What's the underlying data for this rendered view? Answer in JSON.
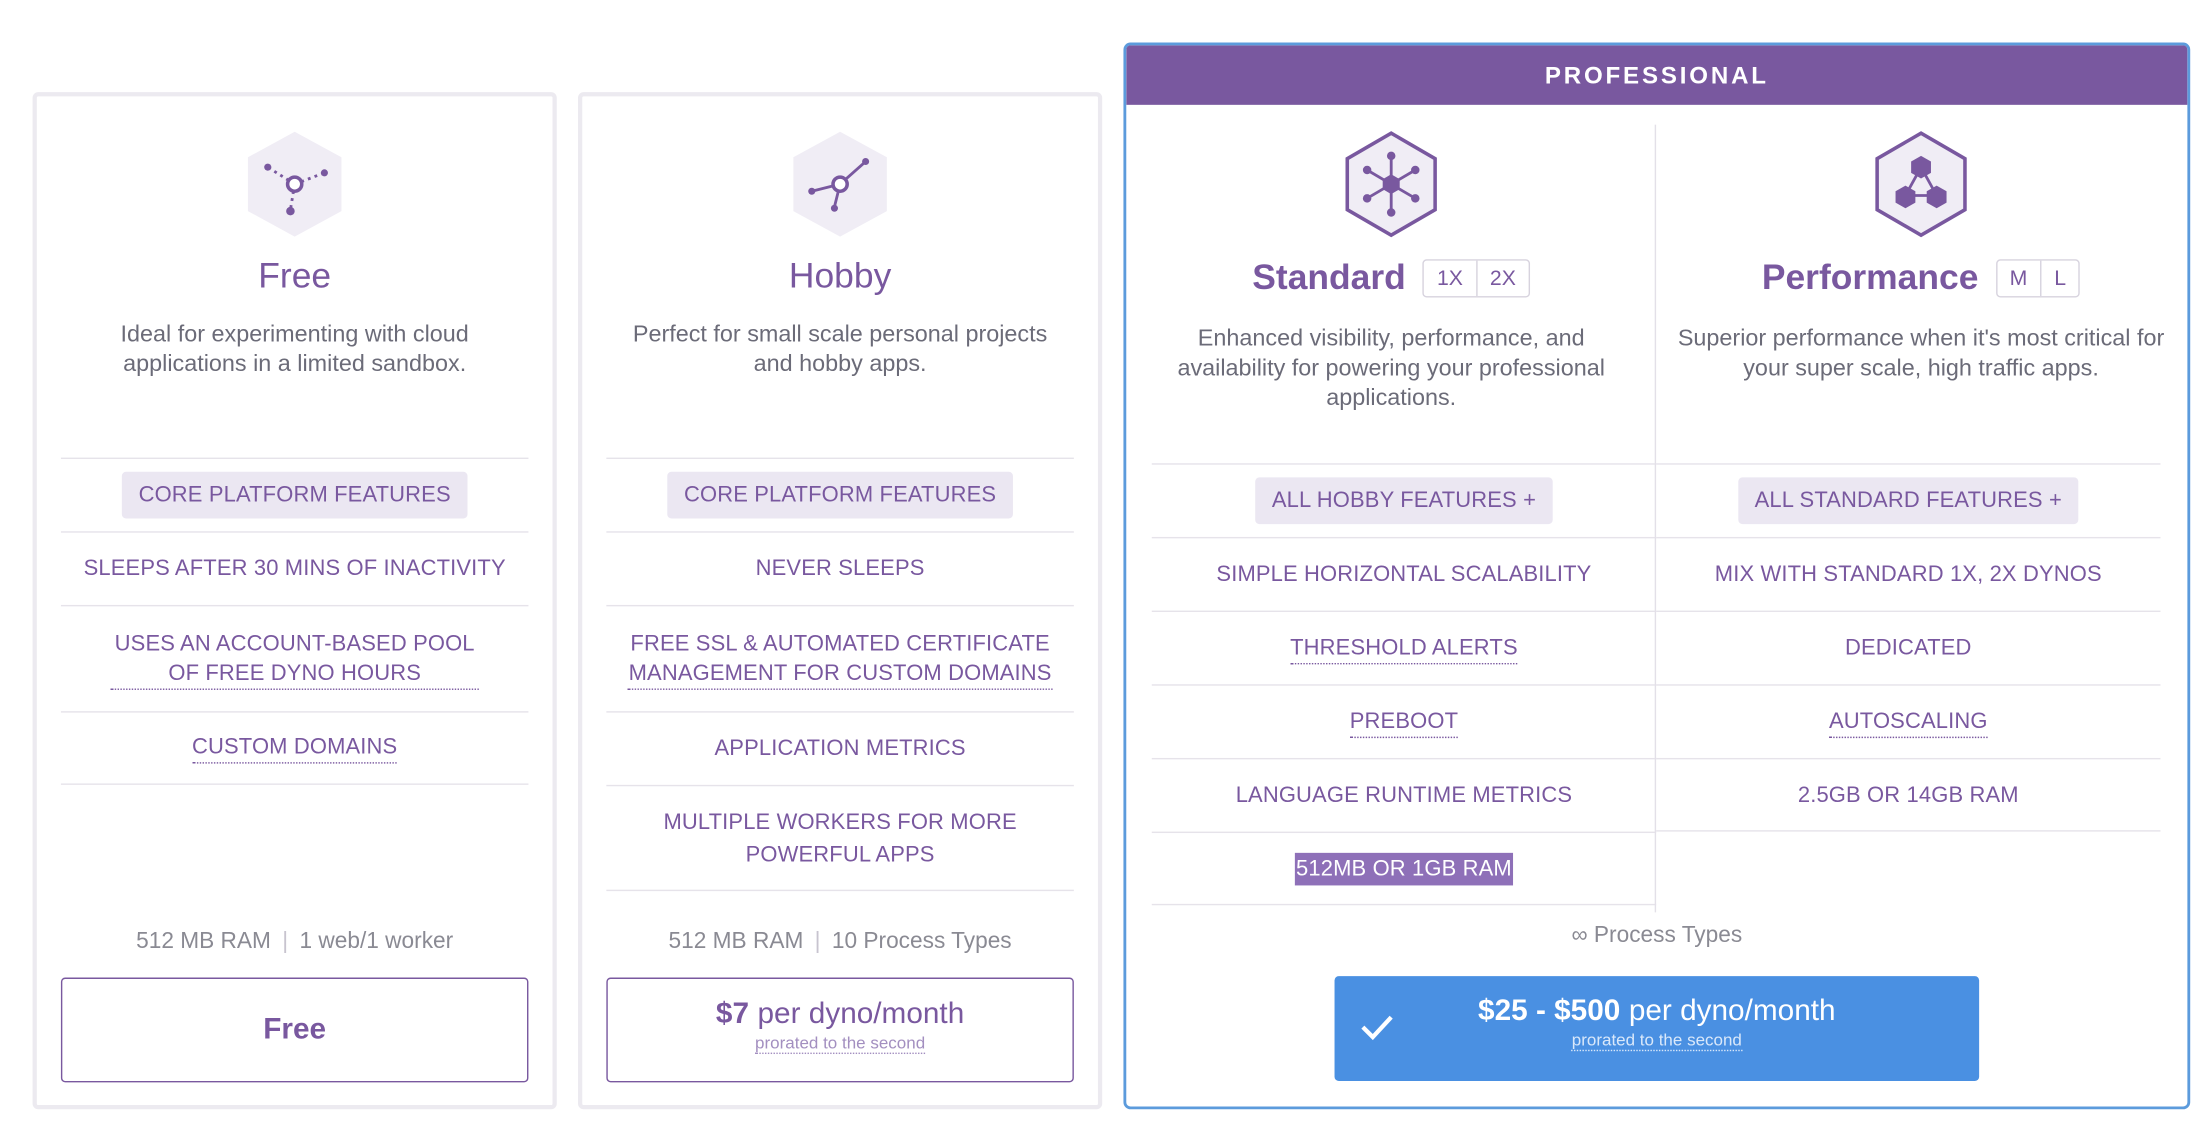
{
  "colors": {
    "brand": "#79589f",
    "accent": "#4a90e2",
    "pill_bg": "#ebe7f2",
    "muted_text": "#8a8a93"
  },
  "plans": {
    "free": {
      "icon": "dyno-free-icon",
      "title": "Free",
      "description": "Ideal for experimenting with cloud applications in a limited sandbox.",
      "features": [
        "CORE PLATFORM FEATURES",
        "SLEEPS AFTER 30 MINS OF INACTIVITY",
        "USES AN ACCOUNT-BASED POOL OF FREE DYNO HOURS",
        "CUSTOM DOMAINS"
      ],
      "ram": "512 MB RAM",
      "processes": "1 web/1 worker",
      "price_label": "Free"
    },
    "hobby": {
      "icon": "dyno-hobby-icon",
      "title": "Hobby",
      "description": "Perfect for small scale personal projects and hobby apps.",
      "features": [
        "CORE PLATFORM FEATURES",
        "NEVER SLEEPS",
        "FREE SSL & AUTOMATED CERTIFICATE MANAGEMENT FOR CUSTOM DOMAINS",
        "APPLICATION METRICS",
        "MULTIPLE WORKERS FOR MORE POWERFUL APPS"
      ],
      "ram": "512 MB RAM",
      "processes": "10 Process Types",
      "price": "$7",
      "price_unit": "per dyno/month",
      "price_note": "prorated to the second"
    },
    "professional": {
      "header": "PROFESSIONAL",
      "standard": {
        "icon": "dyno-standard-icon",
        "title": "Standard",
        "sizes": [
          "1X",
          "2X"
        ],
        "description": "Enhanced visibility, performance, and availability for powering your professional applications.",
        "features": [
          "ALL HOBBY FEATURES +",
          "SIMPLE HORIZONTAL SCALABILITY",
          "THRESHOLD ALERTS",
          "PREBOOT",
          "LANGUAGE RUNTIME METRICS",
          "512MB OR 1GB RAM"
        ]
      },
      "performance": {
        "icon": "dyno-performance-icon",
        "title": "Performance",
        "sizes": [
          "M",
          "L"
        ],
        "description": "Superior performance when it's most critical for your super scale, high traffic apps.",
        "features": [
          "ALL STANDARD FEATURES +",
          "MIX WITH STANDARD 1X, 2X DYNOS",
          "DEDICATED",
          "AUTOSCALING",
          "2.5GB OR 14GB RAM"
        ]
      },
      "processes": "∞ Process Types",
      "price": "$25 - $500",
      "price_unit": "per dyno/month",
      "price_note": "prorated to the second",
      "selected_icon": "checkmark-icon"
    }
  }
}
